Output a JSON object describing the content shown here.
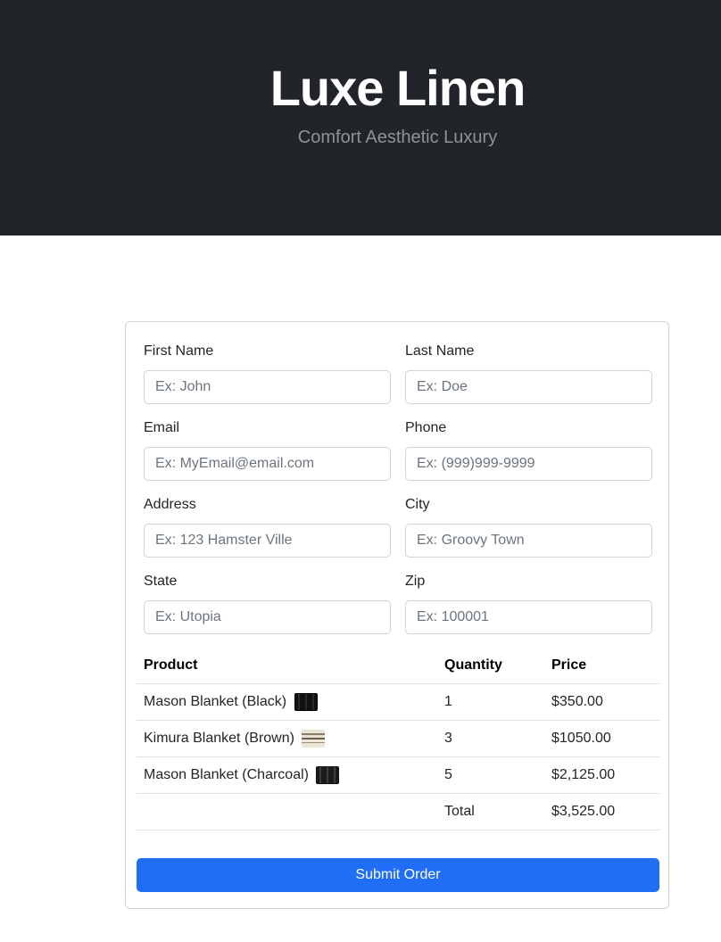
{
  "header": {
    "title": "Luxe Linen",
    "subtitle": "Comfort Aesthetic Luxury",
    "background_color": "#212529"
  },
  "form": {
    "first_name": {
      "label": "First Name",
      "placeholder": "Ex: John"
    },
    "last_name": {
      "label": "Last Name",
      "placeholder": "Ex: Doe"
    },
    "email": {
      "label": "Email",
      "placeholder": "Ex: MyEmail@email.com"
    },
    "phone": {
      "label": "Phone",
      "placeholder": "Ex: (999)999-9999"
    },
    "address": {
      "label": "Address",
      "placeholder": "Ex: 123 Hamster Ville"
    },
    "city": {
      "label": "City",
      "placeholder": "Ex: Groovy Town"
    },
    "state": {
      "label": "State",
      "placeholder": "Ex: Utopia"
    },
    "zip": {
      "label": "Zip",
      "placeholder": "Ex: 100001"
    }
  },
  "order_table": {
    "headers": {
      "product": "Product",
      "quantity": "Quantity",
      "price": "Price"
    },
    "rows": [
      {
        "product": "Mason Blanket (Black)",
        "swatch_icon": "black-blanket-swatch",
        "quantity": "1",
        "price": "$350.00"
      },
      {
        "product": "Kimura Blanket (Brown)",
        "swatch_icon": "brown-striped-blanket-swatch",
        "quantity": "3",
        "price": "$1050.00"
      },
      {
        "product": "Mason Blanket (Charcoal)",
        "swatch_icon": "charcoal-blanket-swatch",
        "quantity": "5",
        "price": "$2,125.00"
      }
    ],
    "total_label": "Total",
    "total_value": "$3,525.00"
  },
  "submit": {
    "label": "Submit Order",
    "color": "#1f6ef5"
  }
}
